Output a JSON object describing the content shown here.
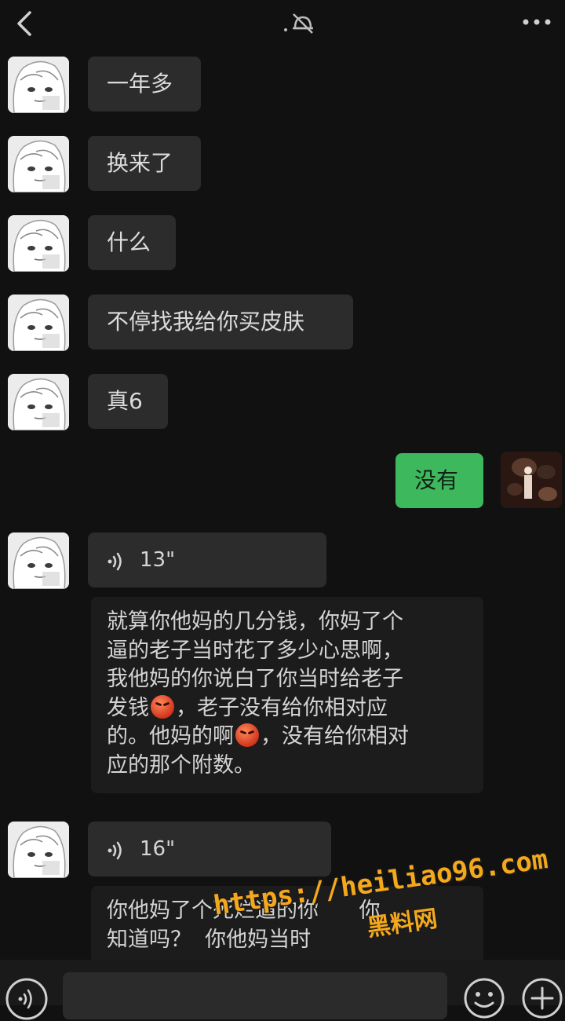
{
  "messages": [
    {
      "type": "text",
      "text": "一年多"
    },
    {
      "type": "text",
      "text": "换来了"
    },
    {
      "type": "text",
      "text": "什么"
    },
    {
      "type": "text",
      "text": "不停找我给你买皮肤"
    },
    {
      "type": "text",
      "text": "真6"
    },
    {
      "type": "text",
      "text": "没有"
    },
    {
      "type": "voice",
      "duration": "13\"",
      "transcript": [
        "就算你他妈的几分钱，你妈了个",
        "逼的老子当时花了多少心思啊，",
        "我他妈的你说白了你当时给老子",
        "发钱",
        "，老子没有给你相对应",
        "的。他妈的啊",
        "，没有给你相对",
        "应的那个附数。"
      ]
    },
    {
      "type": "voice",
      "duration": "16\"",
      "transcript": [
        "你他妈了个死烂逼的你",
        "你",
        "知道吗？",
        "你他妈当时"
      ]
    }
  ],
  "watermark": {
    "url": "https://heiliao96.com",
    "site": "黑料网"
  },
  "icons": {
    "back": "back-arrow-icon",
    "mute": "mute-bell-icon",
    "more": "more-dots-icon",
    "voice_wave": "voice-wave-icon",
    "emoji": "emoji-icon",
    "plus": "plus-icon"
  },
  "colors": {
    "background": "#111111",
    "bubble": "#2c2c2c",
    "self_bubble": "#3eb85c",
    "watermark": "#f4a81c"
  }
}
